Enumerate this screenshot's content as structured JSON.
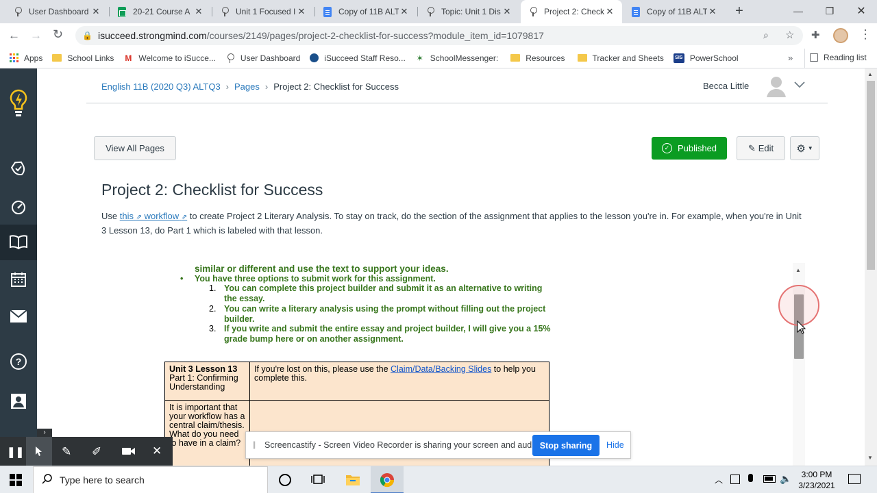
{
  "browser": {
    "tabs": [
      {
        "title": "User Dashboard",
        "icon": "pin-icon",
        "active": false
      },
      {
        "title": "20-21 Course A",
        "icon": "google-sheets-icon",
        "active": false
      },
      {
        "title": "Unit 1 Focused I",
        "icon": "pin-icon",
        "active": false
      },
      {
        "title": "Copy of 11B ALT",
        "icon": "google-docs-icon",
        "active": false
      },
      {
        "title": "Topic: Unit 1 Dis",
        "icon": "pin-icon",
        "active": false
      },
      {
        "title": "Project 2: Check",
        "icon": "pin-icon",
        "active": true
      },
      {
        "title": "Copy of 11B ALT",
        "icon": "google-docs-icon",
        "active": false
      }
    ],
    "url_domain": "isucceed.strongmind.com",
    "url_path": "/courses/2149/pages/project-2-checklist-for-success?module_item_id=1079817",
    "bookmarks": [
      {
        "label": "Apps",
        "icon": "apps-grid-icon"
      },
      {
        "label": "School Links",
        "icon": "folder-icon"
      },
      {
        "label": "Welcome to iSucce...",
        "icon": "gmail-icon"
      },
      {
        "label": "User Dashboard",
        "icon": "pin-icon"
      },
      {
        "label": "iSucceed Staff Reso...",
        "icon": "site-icon"
      },
      {
        "label": "SchoolMessenger:",
        "icon": "messenger-icon"
      },
      {
        "label": "Resources",
        "icon": "folder-icon"
      },
      {
        "label": "Tracker and Sheets",
        "icon": "folder-icon"
      },
      {
        "label": "PowerSchool",
        "icon": "sis-icon"
      }
    ],
    "reading_list": "Reading list",
    "sis_badge": "SIS"
  },
  "header": {
    "breadcrumb": [
      "English 11B (2020 Q3) ALTQ3",
      "Pages",
      "Project 2: Checklist for Success"
    ],
    "user_name": "Becca Little"
  },
  "actions": {
    "view_all": "View All Pages",
    "published": "Published",
    "edit": "Edit"
  },
  "content": {
    "title": "Project 2: Checklist for Success",
    "intro_1": "Use ",
    "link_this": "this",
    "link_workflow": " workflow",
    "intro_2": " to create Project 2 Literary Analysis. To stay on track, do the section of the assignment that applies to the lesson you're in. For example, when you're in Unit 3 Lesson 13, do Part 1 which is labeled with that lesson."
  },
  "doc": {
    "partial_line": "similar or different and use the text to support your ideas.",
    "bullet": "You have three options to submit work for this assignment.",
    "options": [
      "You can complete this project builder and submit it as an alternative to writing the essay.",
      "You can write a literary analysis using the prompt without filling out the project builder.",
      "If you write and submit the entire essay and project builder, I will give you a 15% grade bump here or on another assignment."
    ],
    "table": {
      "lesson": "Unit 3 Lesson 13",
      "part": "Part 1: Confirming Understanding",
      "help_1": "If you're lost on this, please use the ",
      "help_link": "Claim/Data/Backing Slides",
      "help_2": " to help you complete this.",
      "question": "It is important that your workflow has a central claim/thesis. What do you need to have in a claim?"
    }
  },
  "screencastify": {
    "message": "Screencastify - Screen Video Recorder is sharing your screen and audio.",
    "stop": "Stop sharing",
    "hide": "Hide"
  },
  "taskbar": {
    "search_placeholder": "Type here to search",
    "time": "3:00 PM",
    "date": "3/23/2021"
  },
  "colors": {
    "canvas_nav": "#2d3b45",
    "published_green": "#0b9c22",
    "link_blue": "#2b7abc",
    "doc_green": "#38761d",
    "table_fill": "#fce5cd"
  }
}
